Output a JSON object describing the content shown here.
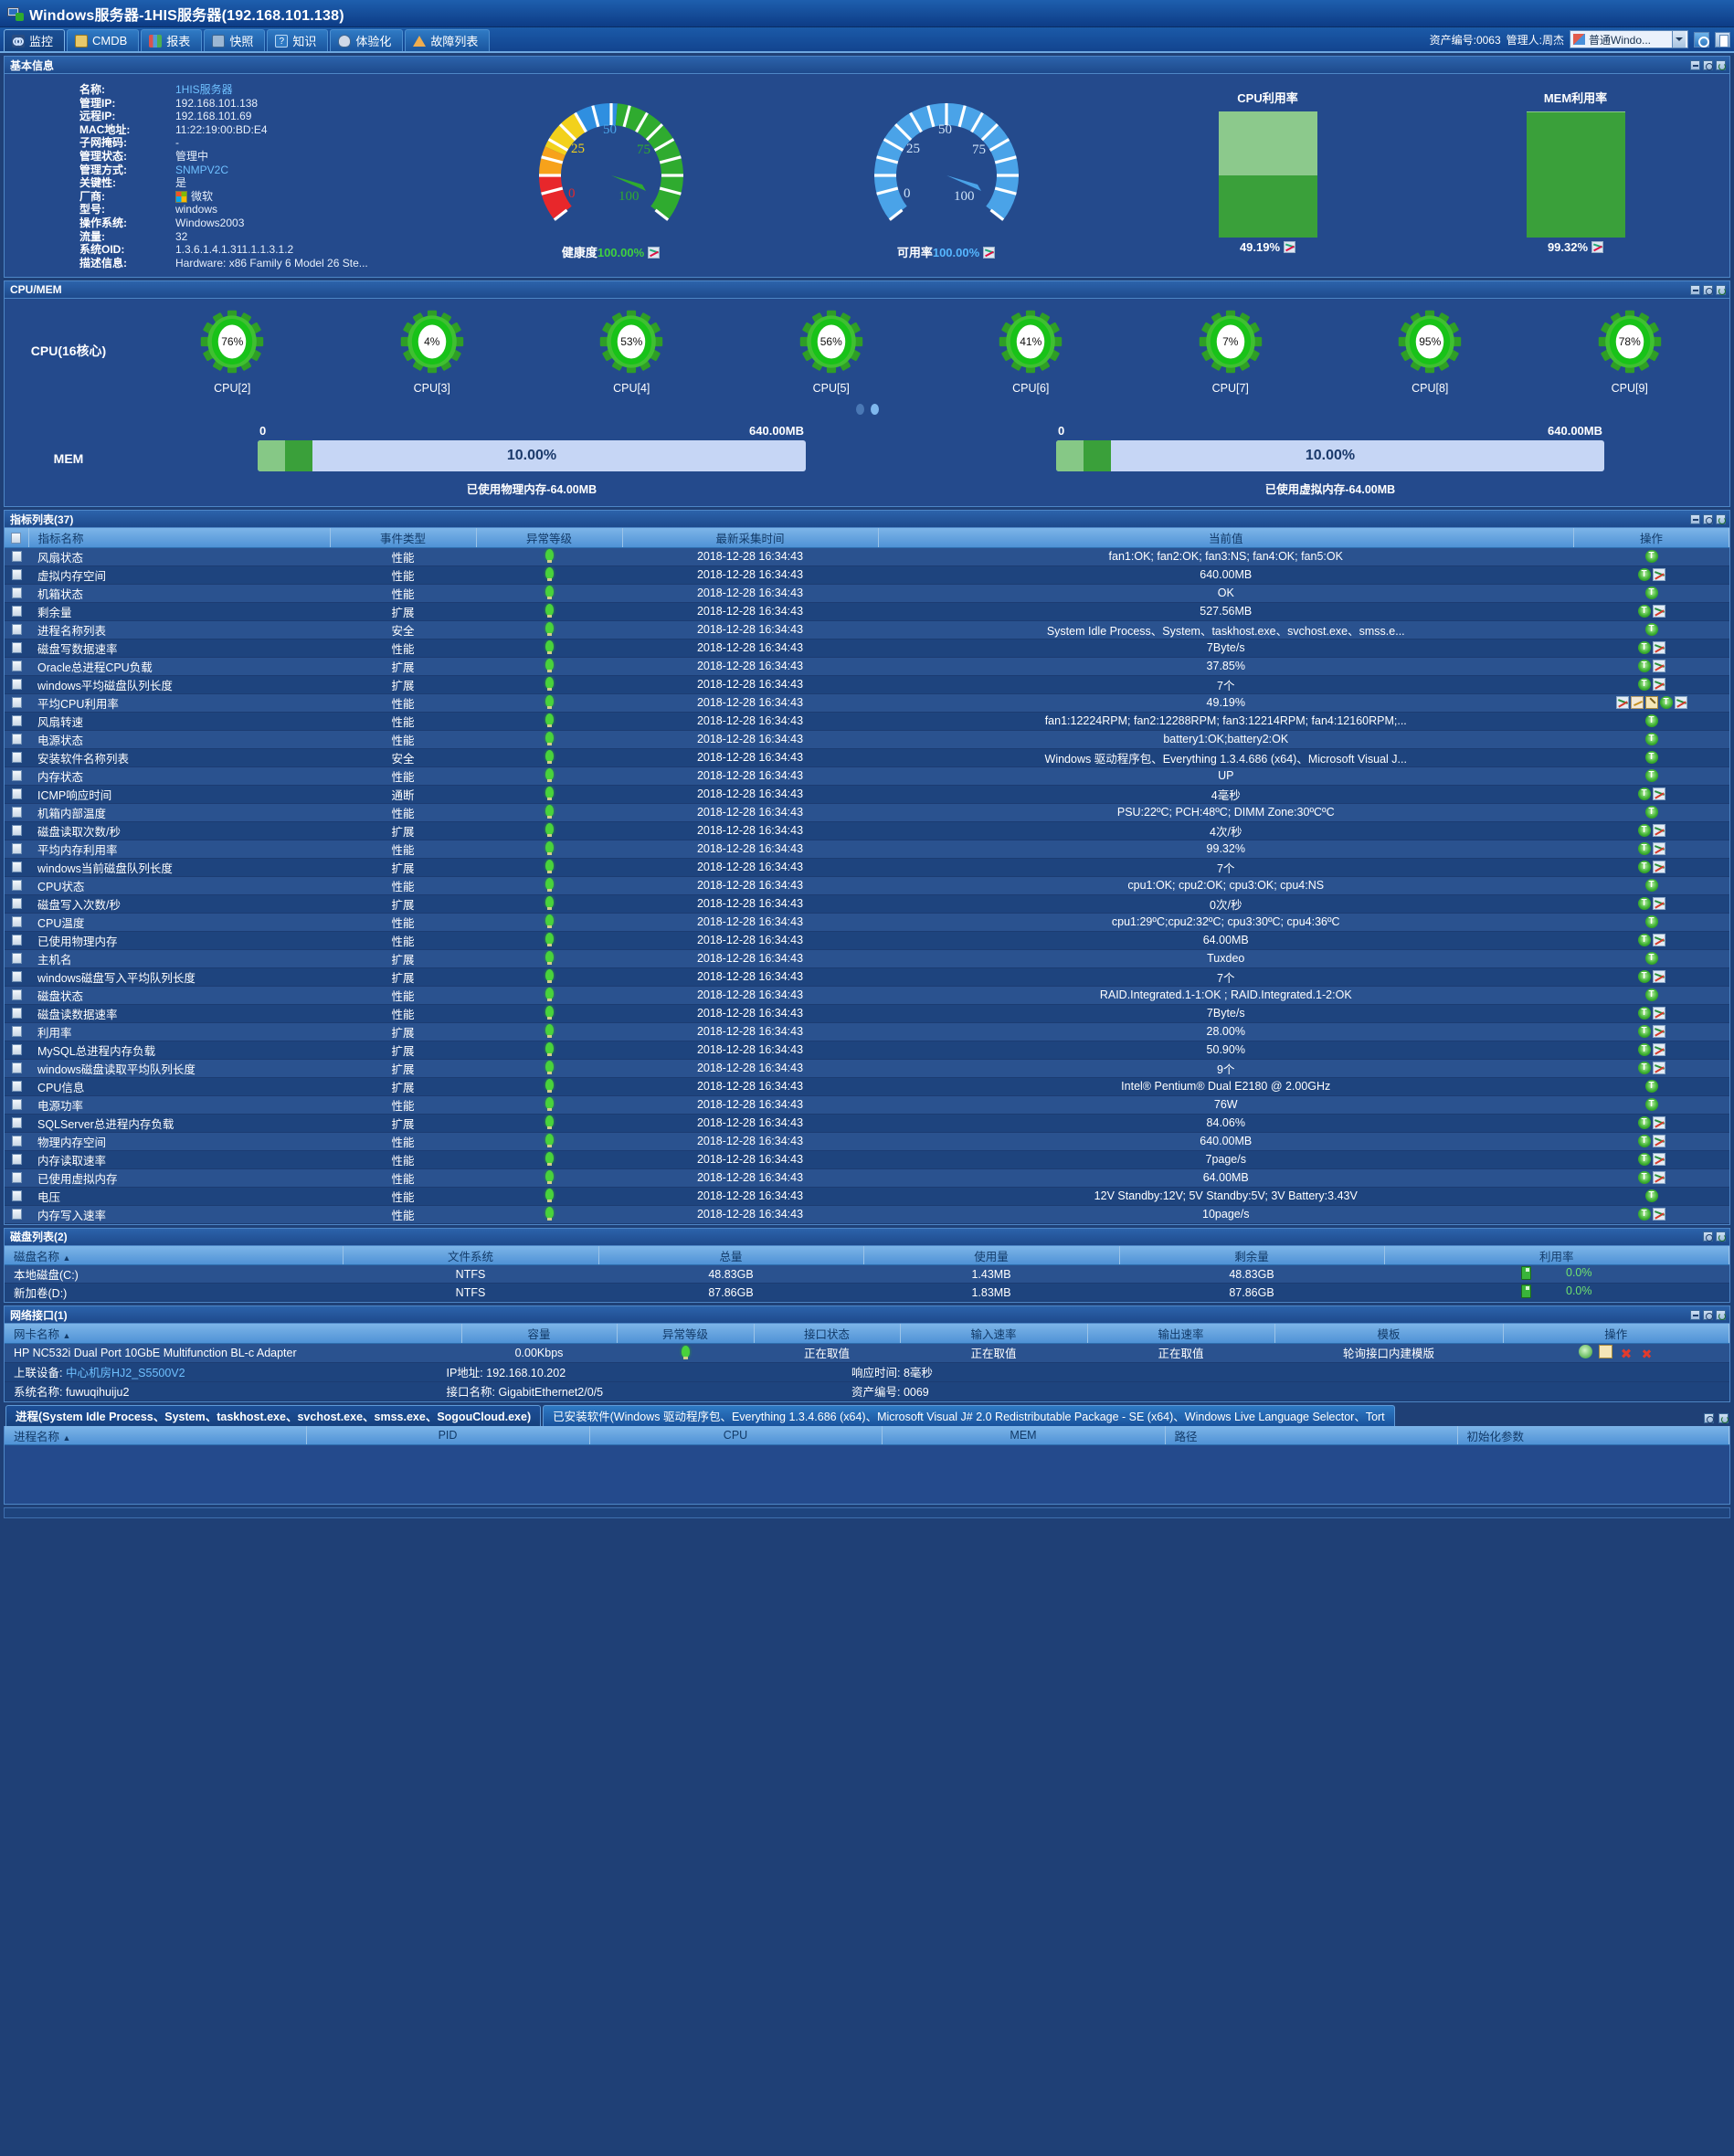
{
  "window": {
    "title": "Windows服务器-1HIS服务器(192.168.101.138)",
    "icon": "windows-server-icon"
  },
  "tabs": [
    {
      "label": "监控",
      "icon": "binoculars-icon",
      "active": true
    },
    {
      "label": "CMDB",
      "icon": "cmdb-icon",
      "active": false
    },
    {
      "label": "报表",
      "icon": "bar-chart-icon",
      "active": false
    },
    {
      "label": "快照",
      "icon": "snapshot-icon",
      "active": false
    },
    {
      "label": "知识",
      "icon": "question-icon",
      "active": false
    },
    {
      "label": "体验化",
      "icon": "experience-icon",
      "active": false
    },
    {
      "label": "故障列表",
      "icon": "warning-triangle-icon",
      "active": false
    }
  ],
  "toolbar_right": {
    "asset_no_label": "资产编号:0063",
    "manager_label": "管理人:周杰",
    "selector_value": "普通Windo...",
    "selector_icon": "flag-icon"
  },
  "basic_info": {
    "title": "基本信息",
    "fields": [
      {
        "key": "名称:",
        "value": "1HIS服务器",
        "link": true
      },
      {
        "key": "管理IP:",
        "value": "192.168.101.138",
        "link": false
      },
      {
        "key": "远程IP:",
        "value": "192.168.101.69",
        "link": false
      },
      {
        "key": "MAC地址:",
        "value": "11:22:19:00:BD:E4",
        "link": false
      },
      {
        "key": "子网掩码:",
        "value": "-",
        "link": false
      },
      {
        "key": "管理状态:",
        "value": "管理中",
        "link": false
      },
      {
        "key": "管理方式:",
        "value": "SNMPV2C",
        "link": true
      },
      {
        "key": "关键性:",
        "value": "是",
        "link": false
      },
      {
        "key": "厂商:",
        "value": "微软",
        "link": false,
        "icon": "microsoft-logo-icon"
      },
      {
        "key": "型号:",
        "value": "windows",
        "link": false
      },
      {
        "key": "操作系统:",
        "value": "Windows2003",
        "link": false
      },
      {
        "key": "流量:",
        "value": "32",
        "link": false
      },
      {
        "key": "系统OID:",
        "value": "1.3.6.1.4.1.311.1.1.3.1.2",
        "link": false
      },
      {
        "key": "描述信息:",
        "value": "Hardware: x86 Family 6 Model 26 Ste...",
        "link": false
      }
    ],
    "gauges": [
      {
        "name": "健康度",
        "value": "100.00%",
        "value_num": 100,
        "color": "#3fbb3f",
        "multicolor": true,
        "ticks": [
          "0",
          "25",
          "50",
          "75",
          "100"
        ]
      },
      {
        "name": "可用率",
        "value": "100.00%",
        "value_num": 100,
        "color": "#4fa8e8",
        "multicolor": false,
        "ticks": [
          "0",
          "25",
          "50",
          "75",
          "100"
        ]
      }
    ],
    "bars": [
      {
        "title": "CPU利用率",
        "value": "49.19%",
        "pct": 49.19,
        "fill": "#3aa03a",
        "track": "#8cc98c"
      },
      {
        "title": "MEM利用率",
        "value": "99.32%",
        "pct": 99.32,
        "fill": "#3aa03a",
        "track": "#8cc98c"
      }
    ]
  },
  "cpumem": {
    "title": "CPU/MEM",
    "cpu_label": "CPU(16核心)",
    "cores": [
      {
        "label": "CPU[2]",
        "value": "76%"
      },
      {
        "label": "CPU[3]",
        "value": "4%"
      },
      {
        "label": "CPU[4]",
        "value": "53%"
      },
      {
        "label": "CPU[5]",
        "value": "56%"
      },
      {
        "label": "CPU[6]",
        "value": "41%"
      },
      {
        "label": "CPU[7]",
        "value": "7%"
      },
      {
        "label": "CPU[8]",
        "value": "95%"
      },
      {
        "label": "CPU[9]",
        "value": "78%"
      }
    ],
    "pager": {
      "pages": 2,
      "active": 2
    },
    "mem_label": "MEM",
    "mem_bars": [
      {
        "min": "0",
        "max": "640.00MB",
        "value": "10.00%",
        "pct": 10,
        "footer": "已使用物理内存-64.00MB"
      },
      {
        "min": "0",
        "max": "640.00MB",
        "value": "10.00%",
        "pct": 10,
        "footer": "已使用虚拟内存-64.00MB"
      }
    ]
  },
  "metrics": {
    "title": "指标列表(37)",
    "columns": [
      "指标名称",
      "事件类型",
      "异常等级",
      "最新采集时间",
      "当前值",
      "操作"
    ],
    "rows": [
      {
        "name": "风扇状态",
        "type": "性能",
        "time": "2018-12-28 16:34:43",
        "value": "fan1:OK; fan2:OK; fan3:NS; fan4:OK; fan5:OK",
        "ops": [
          "t"
        ]
      },
      {
        "name": "虚拟内存空间",
        "type": "性能",
        "time": "2018-12-28 16:34:43",
        "value": "640.00MB",
        "ops": [
          "t",
          "chart"
        ]
      },
      {
        "name": "机箱状态",
        "type": "性能",
        "time": "2018-12-28 16:34:43",
        "value": "OK",
        "ops": [
          "t"
        ]
      },
      {
        "name": "剩余量",
        "type": "扩展",
        "time": "2018-12-28 16:34:43",
        "value": "527.56MB",
        "ops": [
          "t",
          "chart"
        ]
      },
      {
        "name": "进程名称列表",
        "type": "安全",
        "time": "2018-12-28 16:34:43",
        "value": "System Idle Process、System、taskhost.exe、svchost.exe、smss.e...",
        "ops": [
          "t"
        ]
      },
      {
        "name": "磁盘写数据速率",
        "type": "性能",
        "time": "2018-12-28 16:34:43",
        "value": "7Byte/s",
        "ops": [
          "t",
          "chart"
        ]
      },
      {
        "name": "Oracle总进程CPU负载",
        "type": "扩展",
        "time": "2018-12-28 16:34:43",
        "value": "37.85%",
        "ops": [
          "t",
          "chart"
        ]
      },
      {
        "name": "windows平均磁盘队列长度",
        "type": "扩展",
        "time": "2018-12-28 16:34:43",
        "value": "7个",
        "ops": [
          "t",
          "chart"
        ]
      },
      {
        "name": "平均CPU利用率",
        "type": "性能",
        "time": "2018-12-28 16:34:43",
        "value": "49.19%",
        "ops": [
          "chart",
          "chart2",
          "pen",
          "t",
          "chart"
        ]
      },
      {
        "name": "风扇转速",
        "type": "性能",
        "time": "2018-12-28 16:34:43",
        "value": "fan1:12224RPM; fan2:12288RPM; fan3:12214RPM; fan4:12160RPM;...",
        "ops": [
          "t"
        ]
      },
      {
        "name": "电源状态",
        "type": "性能",
        "time": "2018-12-28 16:34:43",
        "value": "battery1:OK;battery2:OK",
        "ops": [
          "t"
        ]
      },
      {
        "name": "安装软件名称列表",
        "type": "安全",
        "time": "2018-12-28 16:34:43",
        "value": "Windows 驱动程序包、Everything 1.3.4.686 (x64)、Microsoft Visual J...",
        "ops": [
          "t"
        ]
      },
      {
        "name": "内存状态",
        "type": "性能",
        "time": "2018-12-28 16:34:43",
        "value": "UP",
        "ops": [
          "t"
        ]
      },
      {
        "name": "ICMP响应时间",
        "type": "通断",
        "time": "2018-12-28 16:34:43",
        "value": "4毫秒",
        "ops": [
          "t",
          "chart"
        ]
      },
      {
        "name": "机箱内部温度",
        "type": "性能",
        "time": "2018-12-28 16:34:43",
        "value": "PSU:22ºC; PCH:48ºC; DIMM Zone:30ºCºC",
        "ops": [
          "t"
        ]
      },
      {
        "name": "磁盘读取次数/秒",
        "type": "扩展",
        "time": "2018-12-28 16:34:43",
        "value": "4次/秒",
        "ops": [
          "t",
          "chart"
        ]
      },
      {
        "name": "平均内存利用率",
        "type": "性能",
        "time": "2018-12-28 16:34:43",
        "value": "99.32%",
        "ops": [
          "t",
          "chart"
        ]
      },
      {
        "name": "windows当前磁盘队列长度",
        "type": "扩展",
        "time": "2018-12-28 16:34:43",
        "value": "7个",
        "ops": [
          "t",
          "chart"
        ]
      },
      {
        "name": "CPU状态",
        "type": "性能",
        "time": "2018-12-28 16:34:43",
        "value": "cpu1:OK; cpu2:OK; cpu3:OK; cpu4:NS",
        "ops": [
          "t"
        ]
      },
      {
        "name": "磁盘写入次数/秒",
        "type": "扩展",
        "time": "2018-12-28 16:34:43",
        "value": "0次/秒",
        "ops": [
          "t",
          "chart"
        ]
      },
      {
        "name": "CPU温度",
        "type": "性能",
        "time": "2018-12-28 16:34:43",
        "value": "cpu1:29ºC;cpu2:32ºC; cpu3:30ºC; cpu4:36ºC",
        "ops": [
          "t"
        ]
      },
      {
        "name": "已使用物理内存",
        "type": "性能",
        "time": "2018-12-28 16:34:43",
        "value": "64.00MB",
        "ops": [
          "t",
          "chart"
        ]
      },
      {
        "name": "主机名",
        "type": "扩展",
        "time": "2018-12-28 16:34:43",
        "value": "Tuxdeo",
        "ops": [
          "t"
        ]
      },
      {
        "name": "windows磁盘写入平均队列长度",
        "type": "扩展",
        "time": "2018-12-28 16:34:43",
        "value": "7个",
        "ops": [
          "t",
          "chart"
        ]
      },
      {
        "name": "磁盘状态",
        "type": "性能",
        "time": "2018-12-28 16:34:43",
        "value": "RAID.Integrated.1-1:OK ; RAID.Integrated.1-2:OK",
        "ops": [
          "t"
        ]
      },
      {
        "name": "磁盘读数据速率",
        "type": "性能",
        "time": "2018-12-28 16:34:43",
        "value": "7Byte/s",
        "ops": [
          "t",
          "chart"
        ]
      },
      {
        "name": "利用率",
        "type": "扩展",
        "time": "2018-12-28 16:34:43",
        "value": "28.00%",
        "ops": [
          "t",
          "chart"
        ]
      },
      {
        "name": "MySQL总进程内存负载",
        "type": "扩展",
        "time": "2018-12-28 16:34:43",
        "value": "50.90%",
        "ops": [
          "t",
          "chart"
        ]
      },
      {
        "name": "windows磁盘读取平均队列长度",
        "type": "扩展",
        "time": "2018-12-28 16:34:43",
        "value": "9个",
        "ops": [
          "t",
          "chart"
        ]
      },
      {
        "name": "CPU信息",
        "type": "扩展",
        "time": "2018-12-28 16:34:43",
        "value": "Intel® Pentium® Dual E2180 @ 2.00GHz",
        "ops": [
          "t"
        ]
      },
      {
        "name": "电源功率",
        "type": "性能",
        "time": "2018-12-28 16:34:43",
        "value": "76W",
        "ops": [
          "t"
        ]
      },
      {
        "name": "SQLServer总进程内存负载",
        "type": "扩展",
        "time": "2018-12-28 16:34:43",
        "value": "84.06%",
        "ops": [
          "t",
          "chart"
        ]
      },
      {
        "name": "物理内存空间",
        "type": "性能",
        "time": "2018-12-28 16:34:43",
        "value": "640.00MB",
        "ops": [
          "t",
          "chart"
        ]
      },
      {
        "name": "内存读取速率",
        "type": "性能",
        "time": "2018-12-28 16:34:43",
        "value": "7page/s",
        "ops": [
          "t",
          "chart"
        ]
      },
      {
        "name": "已使用虚拟内存",
        "type": "性能",
        "time": "2018-12-28 16:34:43",
        "value": "64.00MB",
        "ops": [
          "t",
          "chart"
        ]
      },
      {
        "name": "电压",
        "type": "性能",
        "time": "2018-12-28 16:34:43",
        "value": "12V Standby:12V; 5V Standby:5V; 3V Battery:3.43V",
        "ops": [
          "t"
        ]
      },
      {
        "name": "内存写入速率",
        "type": "性能",
        "time": "2018-12-28 16:34:43",
        "value": "10page/s",
        "ops": [
          "t",
          "chart"
        ]
      }
    ]
  },
  "disks": {
    "title": "磁盘列表(2)",
    "columns": [
      "磁盘名称",
      "文件系统",
      "总量",
      "使用量",
      "剩余量",
      "利用率"
    ],
    "sort_col": "磁盘名称",
    "rows": [
      {
        "name": "本地磁盘(C:)",
        "fs": "NTFS",
        "total": "48.83GB",
        "used": "1.43MB",
        "free": "48.83GB",
        "util": "0.0%"
      },
      {
        "name": "新加卷(D:)",
        "fs": "NTFS",
        "total": "87.86GB",
        "used": "1.83MB",
        "free": "87.86GB",
        "util": "0.0%"
      }
    ]
  },
  "network": {
    "title": "网络接口(1)",
    "columns": [
      "网卡名称",
      "容量",
      "异常等级",
      "接口状态",
      "输入速率",
      "输出速率",
      "模板",
      "操作"
    ],
    "row": {
      "name": "HP NC532i Dual Port 10GbE Multifunction BL-c Adapter",
      "capacity": "0.00Kbps",
      "status": "正在取值",
      "in_rate": "正在取值",
      "out_rate": "正在取值",
      "template": "轮询接口内建模版",
      "uplink_label": "上联设备:",
      "uplink_value": "中心机房HJ2_S5500V2",
      "ip_label": "IP地址:",
      "ip_value": "192.168.10.202",
      "resp_label": "响应时间:",
      "resp_value": "8毫秒",
      "sysname_label": "系统名称:",
      "sysname_value": "fuwuqihuiju2",
      "ifname_label": "接口名称:",
      "ifname_value": "GigabitEthernet2/0/5",
      "asset_label": "资产编号:",
      "asset_value": "0069"
    }
  },
  "bottom": {
    "tabs": [
      {
        "label": "进程(System Idle Process、System、taskhost.exe、svchost.exe、smss.exe、SogouCloud.exe)",
        "active": true
      },
      {
        "label": "已安装软件(Windows 驱动程序包、Everything 1.3.4.686 (x64)、Microsoft Visual J# 2.0 Redistributable Package - SE (x64)、Windows Live Language Selector、Tort",
        "active": false
      }
    ],
    "columns": [
      "进程名称",
      "PID",
      "CPU",
      "MEM",
      "路径",
      "初始化参数"
    ],
    "sort_col": "进程名称"
  }
}
